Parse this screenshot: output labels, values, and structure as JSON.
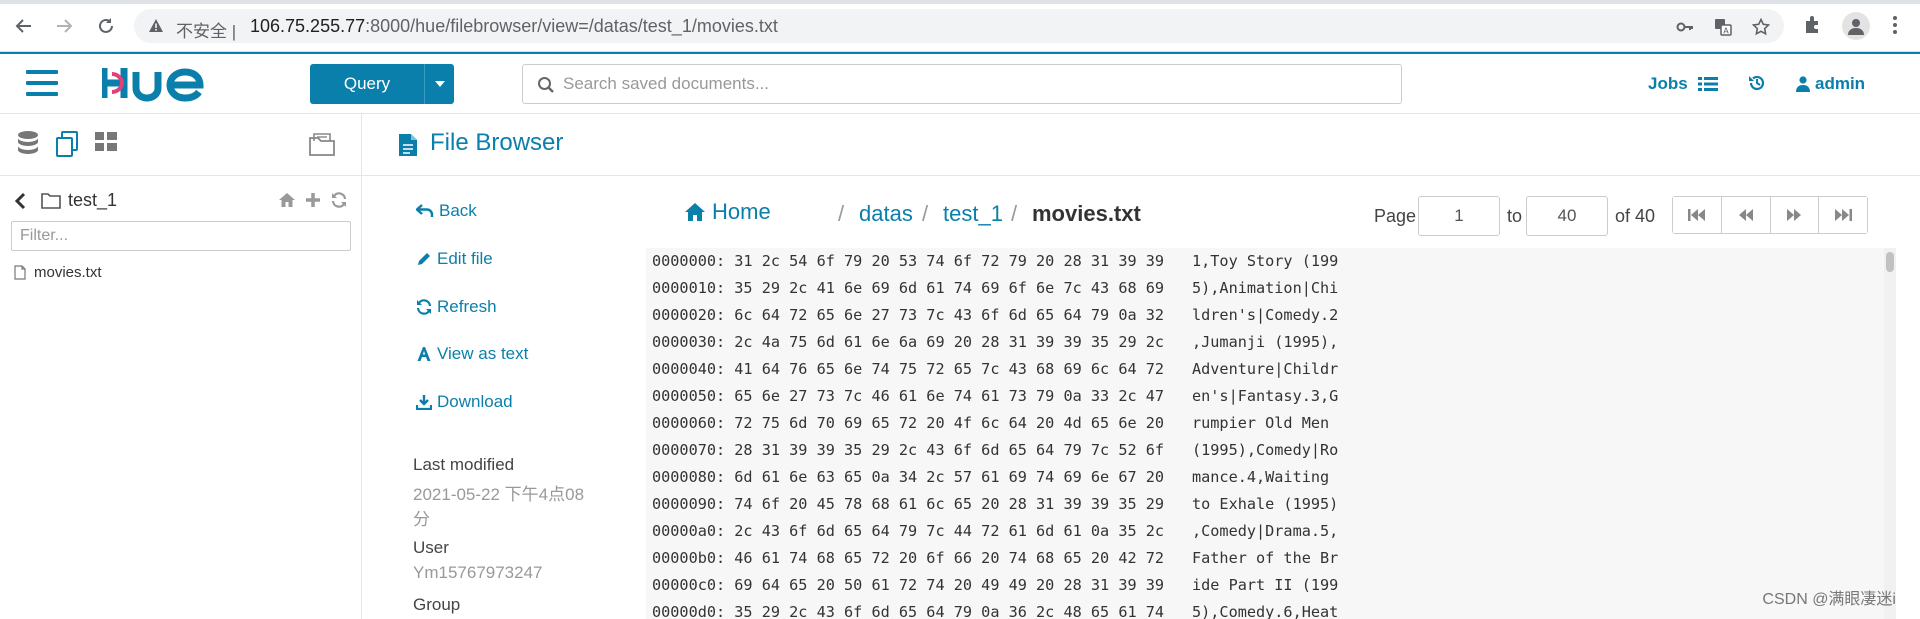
{
  "browser": {
    "security_label": "不安全",
    "separator": "|",
    "url_host": "106.75.255.77",
    "url_rest": ":8000/hue/filebrowser/view=/datas/test_1/movies.txt"
  },
  "header": {
    "query_label": "Query",
    "search_placeholder": "Search saved documents...",
    "jobs_label": "Jobs",
    "user_label": "admin"
  },
  "left_panel": {
    "folder_name": "test_1",
    "filter_placeholder": "Filter...",
    "files": [
      "movies.txt"
    ]
  },
  "main": {
    "title": "File Browser",
    "actions": {
      "back": "Back",
      "edit": "Edit file",
      "refresh": "Refresh",
      "view_text": "View as text",
      "download": "Download"
    },
    "meta": {
      "last_modified_label": "Last modified",
      "last_modified_line1": "2021-05-22 下午4点08",
      "last_modified_line2": "分",
      "user_label": "User",
      "user_value": "Ym15767973247",
      "group_label": "Group"
    },
    "breadcrumb": {
      "home": "Home",
      "sep": "/",
      "datas": "datas",
      "test_1": "test_1",
      "current": "movies.txt"
    },
    "pager": {
      "page_label": "Page",
      "from": "1",
      "to_label": "to",
      "to": "40",
      "of_label": "of 40"
    },
    "hex_rows": [
      {
        "offset": "0000000:",
        "hex": "31 2c 54 6f 79 20 53 74 6f 72 79 20 28 31 39 39",
        "text": "1,Toy Story (199"
      },
      {
        "offset": "0000010:",
        "hex": "35 29 2c 41 6e 69 6d 61 74 69 6f 6e 7c 43 68 69",
        "text": "5),Animation|Chi"
      },
      {
        "offset": "0000020:",
        "hex": "6c 64 72 65 6e 27 73 7c 43 6f 6d 65 64 79 0a 32",
        "text": "ldren's|Comedy.2"
      },
      {
        "offset": "0000030:",
        "hex": "2c 4a 75 6d 61 6e 6a 69 20 28 31 39 39 35 29 2c",
        "text": ",Jumanji (1995),"
      },
      {
        "offset": "0000040:",
        "hex": "41 64 76 65 6e 74 75 72 65 7c 43 68 69 6c 64 72",
        "text": "Adventure|Childr"
      },
      {
        "offset": "0000050:",
        "hex": "65 6e 27 73 7c 46 61 6e 74 61 73 79 0a 33 2c 47",
        "text": "en's|Fantasy.3,G"
      },
      {
        "offset": "0000060:",
        "hex": "72 75 6d 70 69 65 72 20 4f 6c 64 20 4d 65 6e 20",
        "text": "rumpier Old Men "
      },
      {
        "offset": "0000070:",
        "hex": "28 31 39 39 35 29 2c 43 6f 6d 65 64 79 7c 52 6f",
        "text": "(1995),Comedy|Ro"
      },
      {
        "offset": "0000080:",
        "hex": "6d 61 6e 63 65 0a 34 2c 57 61 69 74 69 6e 67 20",
        "text": "mance.4,Waiting "
      },
      {
        "offset": "0000090:",
        "hex": "74 6f 20 45 78 68 61 6c 65 20 28 31 39 39 35 29",
        "text": "to Exhale (1995)"
      },
      {
        "offset": "00000a0:",
        "hex": "2c 43 6f 6d 65 64 79 7c 44 72 61 6d 61 0a 35 2c",
        "text": ",Comedy|Drama.5,"
      },
      {
        "offset": "00000b0:",
        "hex": "46 61 74 68 65 72 20 6f 66 20 74 68 65 20 42 72",
        "text": "Father of the Br"
      },
      {
        "offset": "00000c0:",
        "hex": "69 64 65 20 50 61 72 74 20 49 49 20 28 31 39 39",
        "text": "ide Part II (199"
      },
      {
        "offset": "00000d0:",
        "hex": "35 29 2c 43 6f 6d 65 64 79 0a 36 2c 48 65 61 74",
        "text": "5),Comedy.6,Heat"
      }
    ]
  },
  "watermark": "CSDN @满眼凄迷i",
  "colors": {
    "hue_blue": "#0b7fab",
    "muted_text": "#999999"
  }
}
